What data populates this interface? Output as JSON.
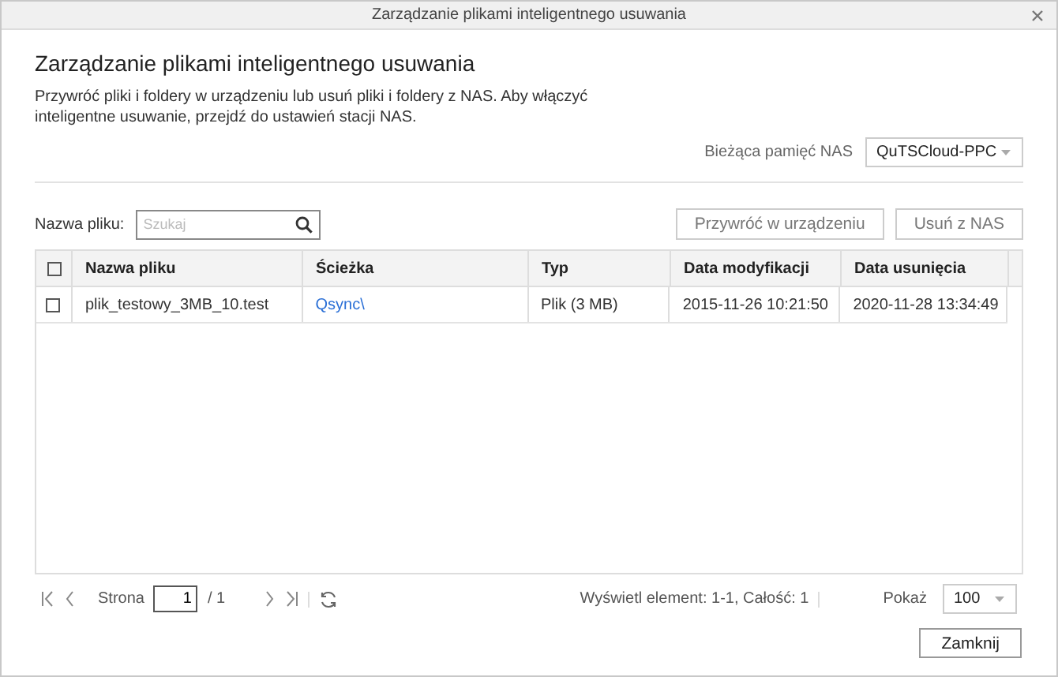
{
  "window": {
    "title": "Zarządzanie plikami inteligentnego usuwania"
  },
  "heading": "Zarządzanie plikami inteligentnego usuwania",
  "description": "Przywróć pliki i foldery w urządzeniu lub usuń pliki i foldery z NAS. Aby włączyć inteligentne usuwanie, przejdź do ustawień stacji NAS.",
  "nas_select": {
    "label": "Bieżąca pamięć NAS",
    "value": "QuTSCloud-PPC"
  },
  "search": {
    "label": "Nazwa pliku:",
    "placeholder": "Szukaj"
  },
  "actions": [
    {
      "label": "Przywróć w urządzeniu",
      "disabled": true
    },
    {
      "label": "Usuń z NAS",
      "disabled": true
    }
  ],
  "table": {
    "select_all_checked": false,
    "columns": [
      "Nazwa pliku",
      "Ścieżka",
      "Typ",
      "Data modyfikacji",
      "Data usunięcia"
    ],
    "rows": [
      {
        "checked": false,
        "cells": [
          "plik_testowy_3MB_10.test",
          "Qsync\\",
          "Plik (3 MB)",
          "2015-11-26 10:21:50",
          "2020-11-28 13:34:49"
        ]
      }
    ]
  },
  "pagination": {
    "page_label": "Strona",
    "page": "1",
    "total_pages": "/ 1",
    "summary": "Wyświetl element: 1-1, Całość: 1",
    "show_label": "Pokaż",
    "page_size": "100"
  },
  "close_button": "Zamknij"
}
